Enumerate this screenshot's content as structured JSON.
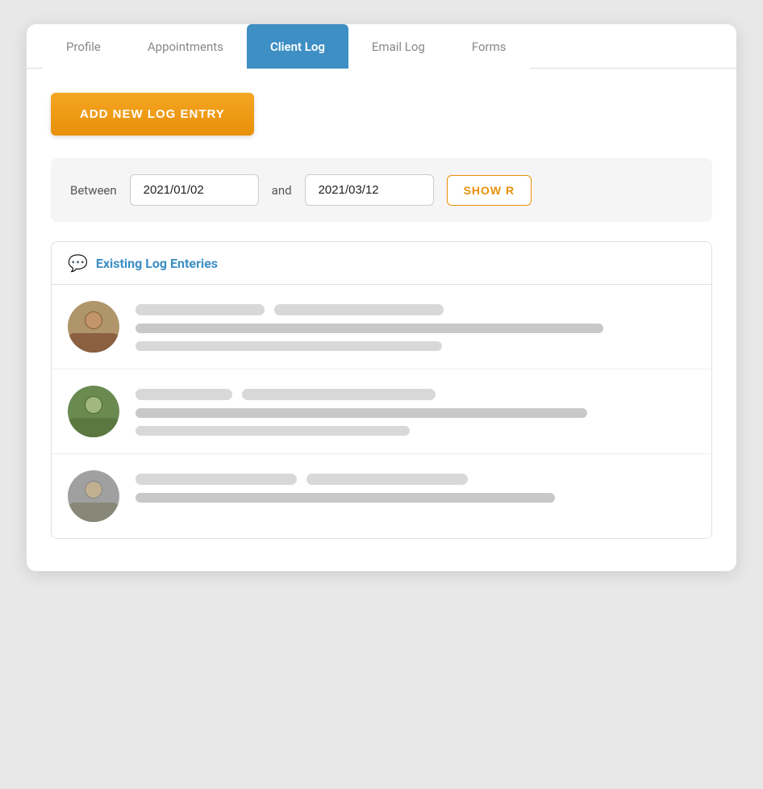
{
  "tabs": [
    {
      "label": "Profile",
      "active": false
    },
    {
      "label": "Appointments",
      "active": false
    },
    {
      "label": "Client Log",
      "active": true
    },
    {
      "label": "Email Log",
      "active": false
    },
    {
      "label": "Forms",
      "active": false
    }
  ],
  "add_button_label": "ADD NEW LOG ENTRY",
  "filter": {
    "between_label": "Between",
    "and_label": "and",
    "date_from": "2021/01/02",
    "date_to": "2021/03/12",
    "show_button_label": "SHOW R"
  },
  "log_section": {
    "icon": "💬",
    "title": "Existing Log Enteries",
    "entries": [
      {
        "id": 1
      },
      {
        "id": 2
      },
      {
        "id": 3
      }
    ]
  }
}
